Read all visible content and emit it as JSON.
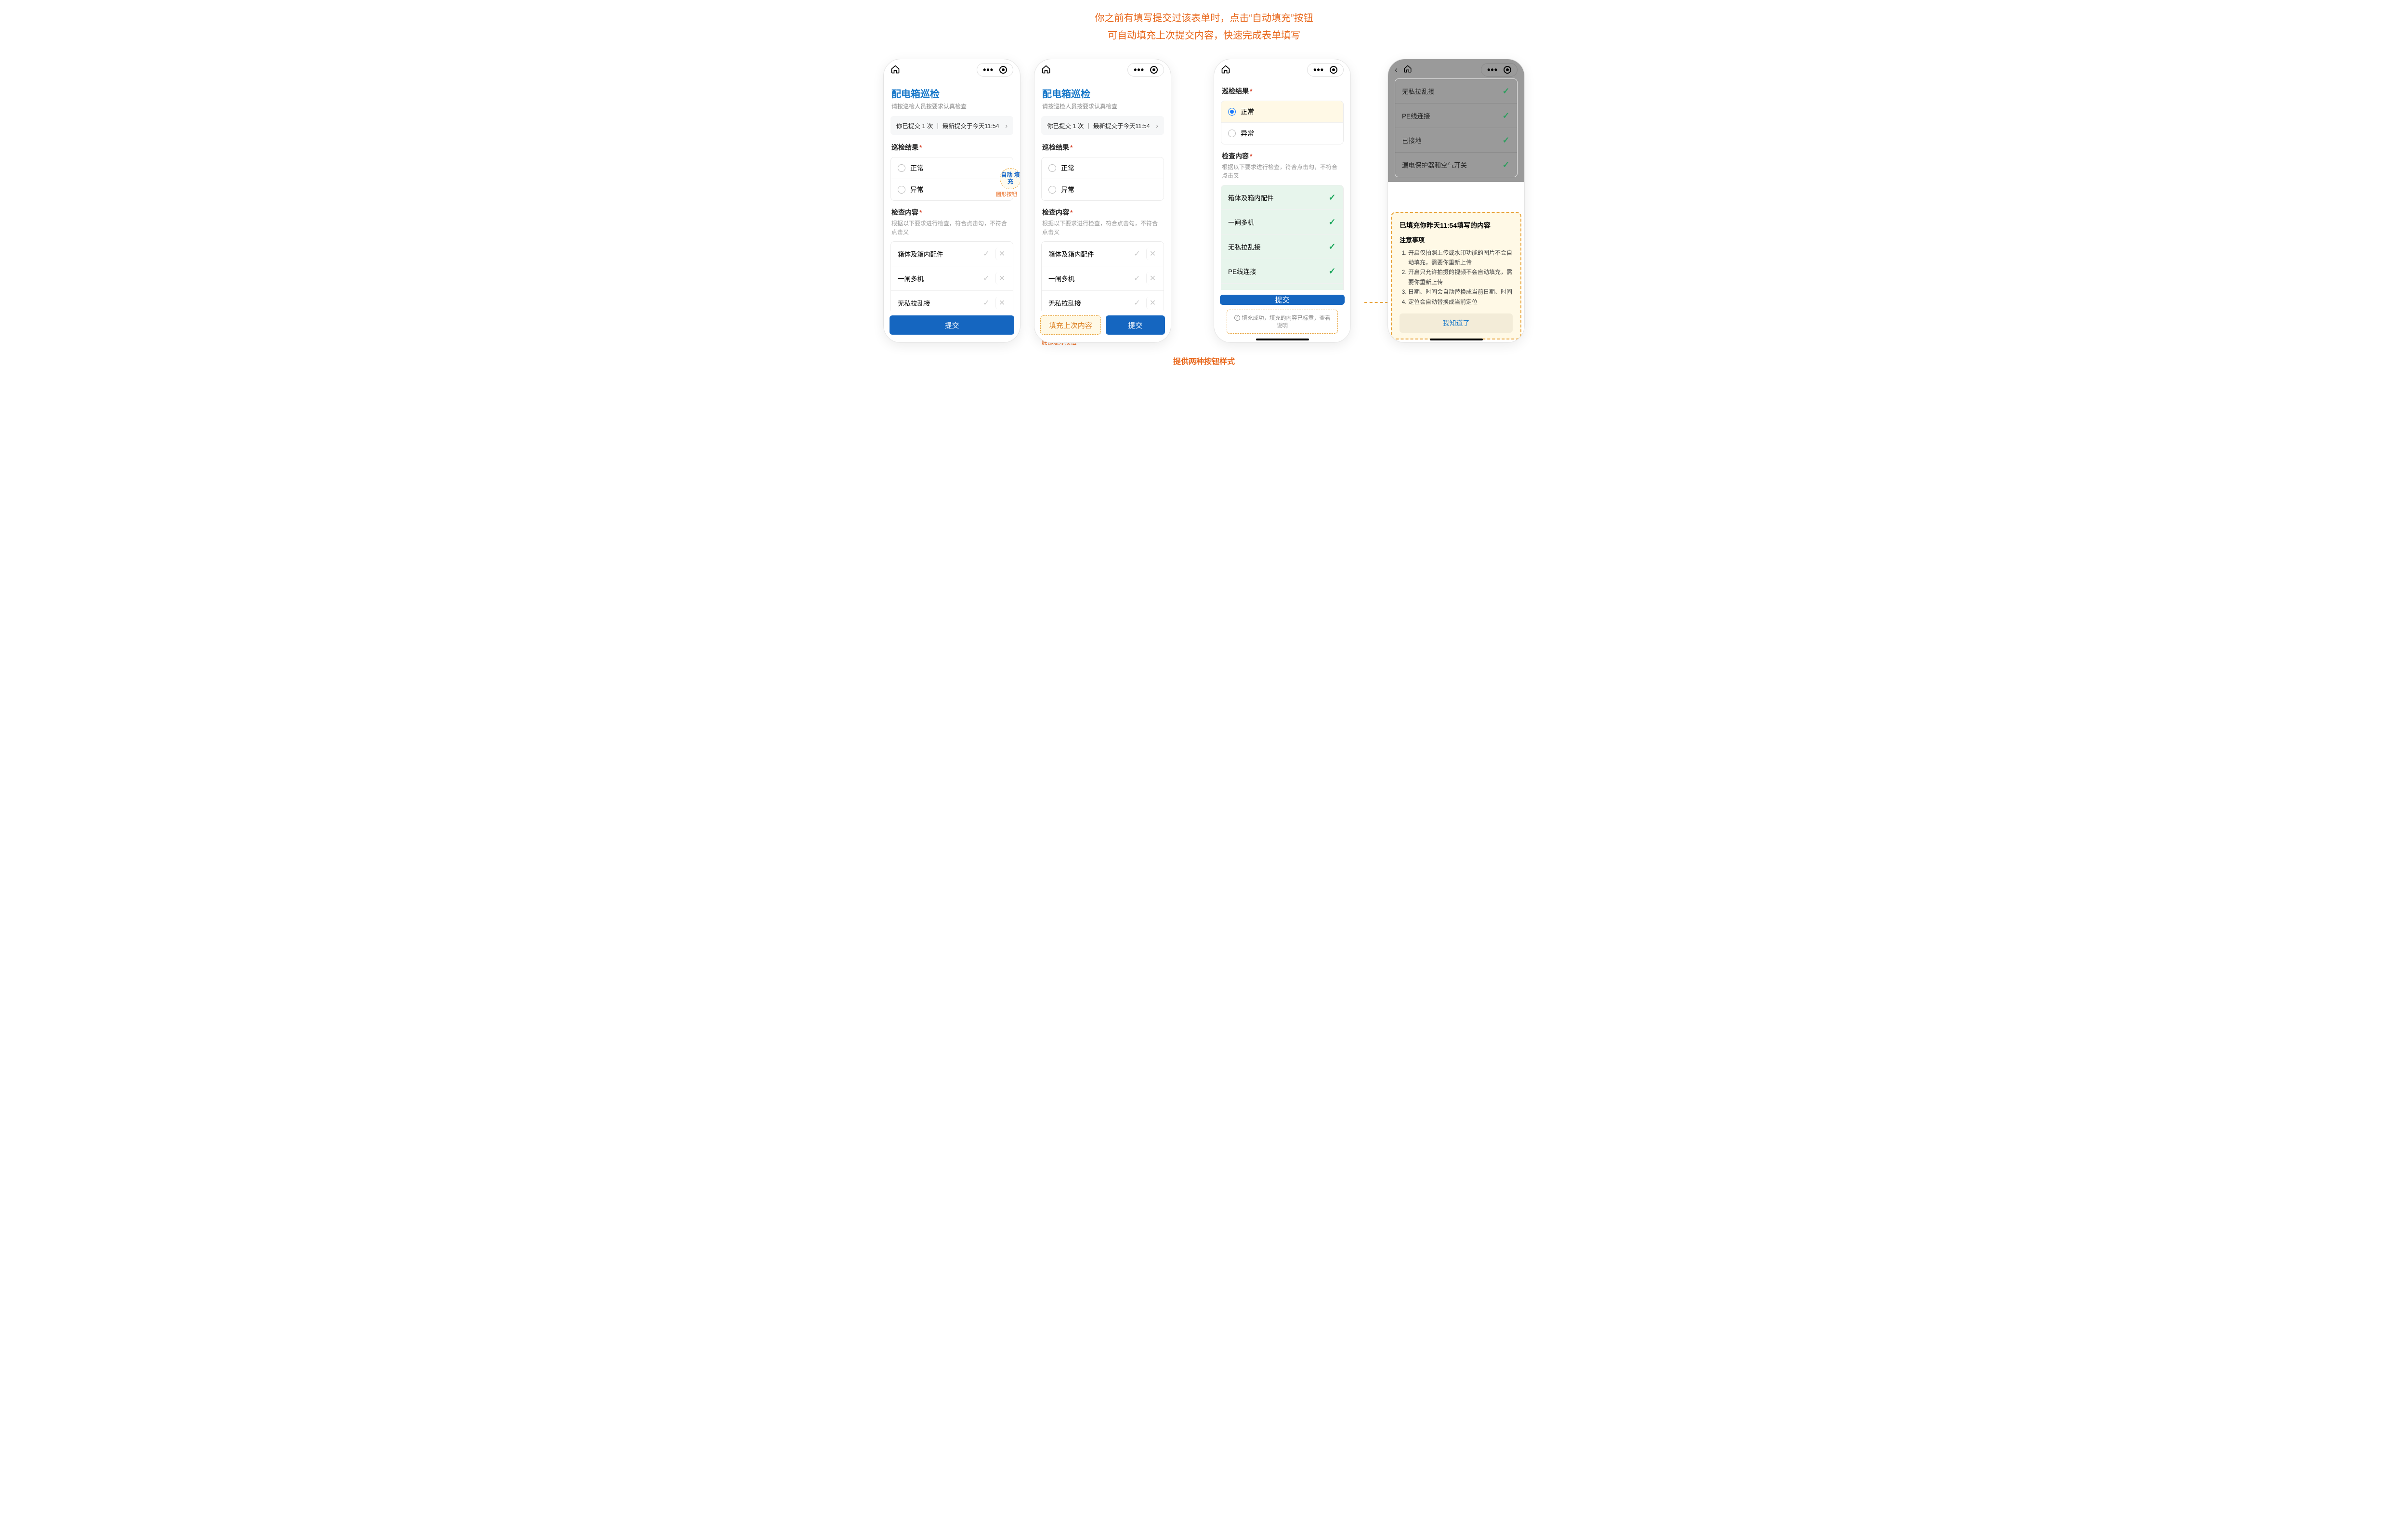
{
  "headline": {
    "line1": "你之前有填写提交过该表单时，点击“自动填充”按钮",
    "line2": "可自动填充上次提交内容，快速完成表单填写"
  },
  "common": {
    "form_title": "配电箱巡检",
    "form_subtitle": "请按巡检人员按要求认真检查",
    "history": "你已提交 1 次 ｜ 最新提交于今天11:54",
    "section_result": "巡检结果",
    "section_items": "检查内容",
    "items_desc": "根据以下要求进行检查，符合点击勾，不符合点击叉",
    "required": "*",
    "opt_normal": "正常",
    "opt_abnormal": "异常",
    "submit": "提交",
    "fill_last": "填充上次内容"
  },
  "autofill_badge": "自动\n填充",
  "badge_label": "圆形按钮",
  "outline_caption": "底部悬浮按钮",
  "footnote": "提供两种按钮样式",
  "check_items": {
    "a": "箱体及箱内配件",
    "b": "一闸多机",
    "c": "无私拉乱接",
    "d": "PE线连接",
    "e": "已接地",
    "f": "漏电保护器和空气开关"
  },
  "phone3": {
    "toast": "填充成功，填充的内容已标黄，查看说明"
  },
  "sheet": {
    "title": "已填充你昨天11:54填写的内容",
    "notes_label": "注意事项",
    "n1": "开启仅拍照上传或水印功能的图片不会自动填充，需要你重新上传",
    "n2": "开启只允许拍摄的视频不会自动填充，需要你重新上传",
    "n3": "日期、时间会自动替换成当前日期、时间",
    "n4": "定位会自动替换成当前定位",
    "ack": "我知道了"
  }
}
